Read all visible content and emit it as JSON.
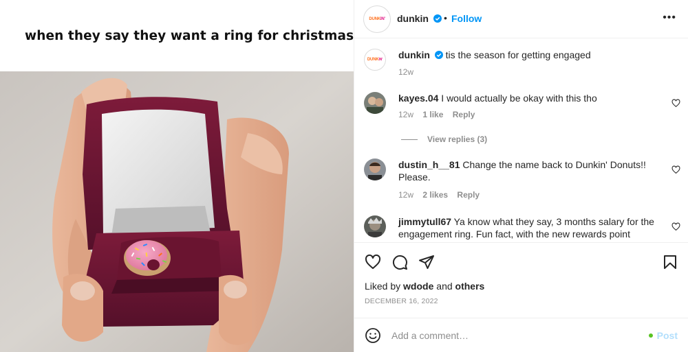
{
  "media": {
    "caption": "when they say they want a ring for christmas"
  },
  "header": {
    "account": "dunkin",
    "logo_text_left": "DUNK",
    "logo_text_right": "IN'",
    "separator": "•",
    "follow_label": "Follow",
    "more_label": "•••"
  },
  "post": {
    "account": "dunkin",
    "caption": "tis the season for getting engaged",
    "age": "12w"
  },
  "comments": [
    {
      "user": "kayes.04",
      "text": "I would actually be okay with this tho",
      "age": "12w",
      "likes": "1 like",
      "reply_label": "Reply"
    },
    {
      "user": "dustin_h__81",
      "text": "Change the name back to Dunkin' Donuts!! Please.",
      "age": "12w",
      "likes": "2 likes",
      "reply_label": "Reply"
    },
    {
      "user": "jimmytull67",
      "text": "Ya know what they say, 3 months salary for the engagement ring. Fun fact, with the new rewards point"
    }
  ],
  "view_replies": "View replies (3)",
  "actions": {
    "liked_prefix": "Liked by",
    "liked_user": "wdode",
    "liked_and": "and",
    "liked_others": "others",
    "date": "DECEMBER 16, 2022"
  },
  "composer": {
    "placeholder": "Add a comment…",
    "post_label": "Post"
  },
  "colors": {
    "accent_blue": "#0095f6",
    "post_disabled": "#b2dffc",
    "dunkin_orange": "#ff6e1b",
    "dunkin_pink": "#e11383",
    "box_velvet": "#6b1530"
  },
  "icons": [
    "verified-badge-icon",
    "more-options-icon",
    "heart-icon",
    "comment-icon",
    "share-icon",
    "bookmark-icon",
    "emoji-icon"
  ]
}
